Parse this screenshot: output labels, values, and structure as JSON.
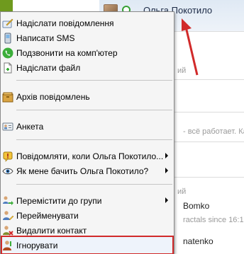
{
  "header": {
    "contact_name": "Ольга Покотило"
  },
  "background": {
    "snippets": [
      {
        "text": "ий"
      },
      {
        "text": "- всё работает. Ка"
      },
      {
        "text": "ий"
      },
      {
        "text": "Bomko"
      },
      {
        "text": "ractals since 16:13."
      },
      {
        "text": "natenko"
      }
    ]
  },
  "menu": {
    "items": [
      {
        "label": "Надіслати повідомлення",
        "icon": "pencil-message-icon",
        "submenu": false
      },
      {
        "label": "Написати SMS",
        "icon": "sms-icon",
        "submenu": false
      },
      {
        "label": "Подзвонити на комп'ютер",
        "icon": "phone-call-icon",
        "submenu": false
      },
      {
        "label": "Надіслати файл",
        "icon": "send-file-icon",
        "submenu": false
      },
      {
        "label": "Архів повідомлень",
        "icon": "archive-icon",
        "submenu": false
      },
      {
        "label": "Анкета",
        "icon": "profile-card-icon",
        "submenu": false
      },
      {
        "label": "Повідомляти, коли Ольга Покотило...",
        "icon": "alert-notify-icon",
        "submenu": true
      },
      {
        "label": "Як мене бачить Ольга Покотило?",
        "icon": "eye-icon",
        "submenu": true
      },
      {
        "label": "Перемістити до групи",
        "icon": "move-group-icon",
        "submenu": true
      },
      {
        "label": "Перейменувати",
        "icon": "rename-user-icon",
        "submenu": false
      },
      {
        "label": "Видалити контакт",
        "icon": "delete-contact-icon",
        "submenu": false
      },
      {
        "label": "Ігнорувати",
        "icon": "ignore-user-icon",
        "submenu": false
      }
    ],
    "highlighted_item": "Ігнорувати"
  },
  "colors": {
    "annotation_red": "#d12a2a",
    "status_online": "#35a034",
    "menu_background": "#f5f5f5"
  }
}
